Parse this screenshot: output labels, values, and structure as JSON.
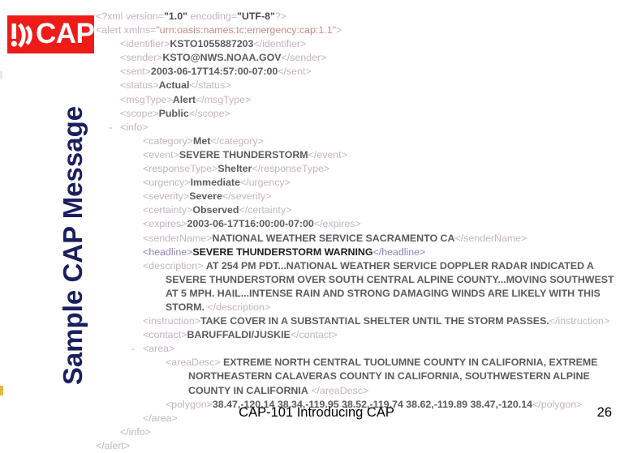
{
  "slide": {
    "vertical_title": "Sample CAP Message",
    "logo": {
      "text": "CAP",
      "icon": "alert-broadcast-icon",
      "background_color": "#ee1c18",
      "text_color": "#ffffff"
    },
    "title_color": "#1b1f5e"
  },
  "xml": {
    "colors": {
      "tag": "#c3b3c2",
      "value": "#5c5a5e",
      "attribute_name": "#c98a86",
      "emphasis_value": "#1d1b20"
    },
    "declaration": {
      "open": "<?xml version=",
      "version_value": "\"1.0\"",
      "encoding_label": " encoding=",
      "encoding_value": "\"UTF-8\"",
      "close": "?>"
    },
    "root": {
      "open": "<alert xmlns=",
      "namespace": "\"urn:oasis:names:tc:emergency:cap:1.1\"",
      "close": ">",
      "closing_tag": "</alert>"
    },
    "toggles": {
      "info": "-",
      "area": "-"
    },
    "elements": [
      {
        "tag": "identifier",
        "value": "KSTO1055887203"
      },
      {
        "tag": "sender",
        "value": "KSTO@NWS.NOAA.GOV"
      },
      {
        "tag": "sent",
        "value": "2003-06-17T14:57:00-07:00"
      },
      {
        "tag": "status",
        "value": "Actual"
      },
      {
        "tag": "msgType",
        "value": "Alert"
      },
      {
        "tag": "scope",
        "value": "Public"
      }
    ],
    "info_open": "<info>",
    "info_close": "</info>",
    "info_elements": [
      {
        "tag": "category",
        "value": "Met"
      },
      {
        "tag": "event",
        "value": "SEVERE THUNDERSTORM"
      },
      {
        "tag": "responseType",
        "value": "Shelter"
      },
      {
        "tag": "urgency",
        "value": "Immediate"
      },
      {
        "tag": "severity",
        "value": "Severe"
      },
      {
        "tag": "certainty",
        "value": "Observed"
      },
      {
        "tag": "expires",
        "value": "2003-06-17T16:00:00-07:00"
      },
      {
        "tag": "senderName",
        "value": "NATIONAL WEATHER SERVICE SACRAMENTO CA"
      }
    ],
    "headline": {
      "tag": "headline",
      "value": "SEVERE THUNDERSTORM WARNING",
      "emphasized": true
    },
    "description": {
      "tag": "description",
      "value": "AT 254 PM PDT...NATIONAL WEATHER SERVICE DOPPLER RADAR INDICATED A SEVERE THUNDERSTORM OVER SOUTH CENTRAL ALPINE COUNTY...MOVING SOUTHWEST AT 5 MPH. HAIL...INTENSE RAIN AND STRONG DAMAGING WINDS ARE LIKELY WITH THIS STORM."
    },
    "instruction": {
      "tag": "instruction",
      "value": "TAKE COVER IN A SUBSTANTIAL SHELTER UNTIL THE STORM PASSES."
    },
    "contact": {
      "tag": "contact",
      "value": "BARUFFALDI/JUSKIE"
    },
    "area_open": "<area>",
    "area_close": "</area>",
    "area_desc": {
      "tag": "areaDesc",
      "value": "EXTREME NORTH CENTRAL TUOLUMNE COUNTY IN CALIFORNIA, EXTREME NORTHEASTERN CALAVERAS COUNTY IN CALIFORNIA, SOUTHWESTERN ALPINE COUNTY IN CALIFORNIA"
    },
    "polygon": {
      "tag": "polygon",
      "value": "38.47,-120.14 38.34,-119.95 38.52,-119.74 38.62,-119.89 38.47,-120.14"
    }
  },
  "footer": {
    "course": "CAP-101 Introducing CAP",
    "page_number": "26"
  }
}
